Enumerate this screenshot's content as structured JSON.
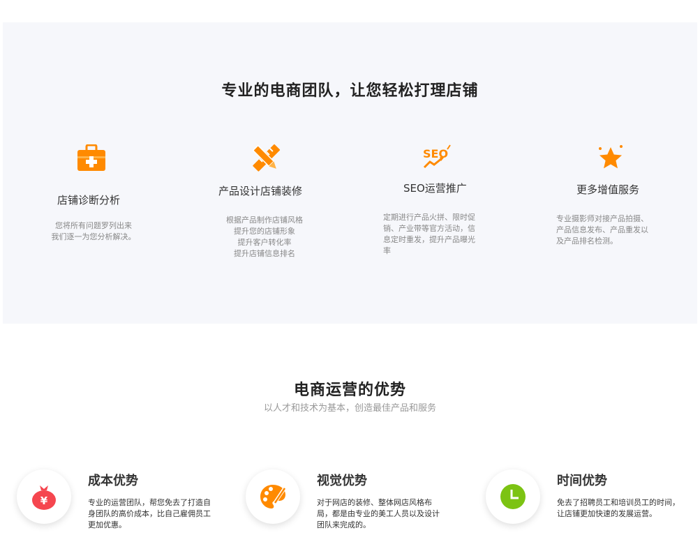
{
  "services": {
    "title": "专业的电商团队，让您轻松打理店铺",
    "items": [
      {
        "icon": "medical-kit-icon",
        "name": "店铺诊断分析",
        "desc": "您将所有问题罗列出来\n我们逐一为您分析解决。"
      },
      {
        "icon": "pencil-ruler-icon",
        "name": "产品设计店铺装修",
        "desc": "根据产品制作店铺风格\n提升您的店铺形象\n提升客户转化率\n提升店铺信息排名"
      },
      {
        "icon": "seo-icon",
        "name": "SEO运营推广",
        "desc": "定期进行产品火拼、限时促\n销、产业带等官方活动，信\n息定时重发，提升产品曝光\n率"
      },
      {
        "icon": "star-icon",
        "name": "更多增值服务",
        "desc": "专业摄影师对接产品拍摄、\n产品信息发布、产品重发以\n及产品排名检测。"
      }
    ],
    "accent": "#ff8a00"
  },
  "advantages": {
    "title": "电商运营的优势",
    "subtitle": "以人才和技术为基本，创造最佳产品和服务",
    "items": [
      {
        "icon": "money-bag-icon",
        "name": "成本优势",
        "desc": "专业的运营团队，帮您免去了打造自\n身团队的高价成本，比自己雇佣员工\n更加优惠。",
        "color": "#f5464f"
      },
      {
        "icon": "palette-icon",
        "name": "视觉优势",
        "desc": "对于网店的装修、整体网店风格布\n局，都是由专业的美工人员以及设计\n团队来完成的。",
        "color": "#ff8a00"
      },
      {
        "icon": "clock-icon",
        "name": "时间优势",
        "desc": "免去了招聘员工和培训员工的时间，\n让店铺更加快速的发展运营。",
        "color": "#7cc313"
      }
    ]
  }
}
